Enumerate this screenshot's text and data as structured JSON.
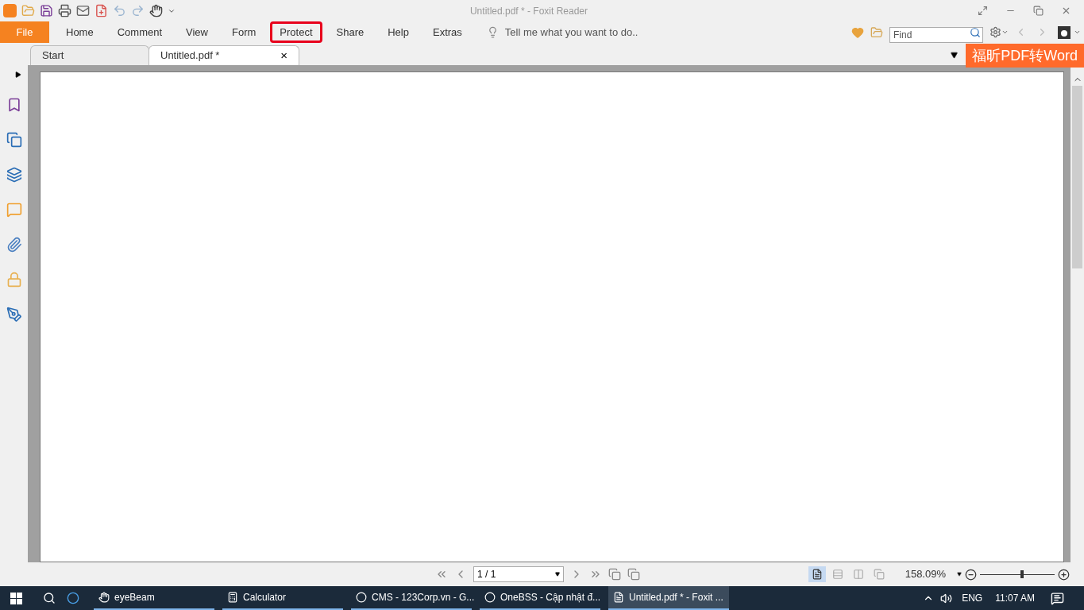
{
  "window": {
    "title": "Untitled.pdf * - Foxit Reader"
  },
  "ribbon_tabs": [
    {
      "label": "File",
      "kind": "file",
      "highlighted": false
    },
    {
      "label": "Home",
      "kind": "tab",
      "highlighted": false
    },
    {
      "label": "Comment",
      "kind": "tab",
      "highlighted": false
    },
    {
      "label": "View",
      "kind": "tab",
      "highlighted": false
    },
    {
      "label": "Form",
      "kind": "tab",
      "highlighted": false
    },
    {
      "label": "Protect",
      "kind": "tab",
      "highlighted": true
    },
    {
      "label": "Share",
      "kind": "tab",
      "highlighted": false
    },
    {
      "label": "Help",
      "kind": "tab",
      "highlighted": false
    },
    {
      "label": "Extras",
      "kind": "tab",
      "highlighted": false
    }
  ],
  "tell_me": {
    "placeholder": "Tell me what you want to do.."
  },
  "find": {
    "placeholder": "Find"
  },
  "doc_tabs": [
    {
      "label": "Start",
      "selected": false
    },
    {
      "label": "Untitled.pdf *",
      "selected": true,
      "close": "×"
    }
  ],
  "promo_banner": "福昕PDF转Word",
  "status_bar": {
    "page_field": "1 / 1",
    "zoom": "158.09%",
    "level": 0.56,
    "view_modes": [
      {
        "selected": true
      },
      {
        "selected": false
      },
      {
        "selected": false
      },
      {
        "selected": false
      }
    ]
  },
  "taskbar": {
    "apps": [
      {
        "label": "eyeBeam",
        "selected": false
      },
      {
        "label": "Calculator",
        "selected": false
      },
      {
        "label": "CMS - 123Corp.vn - G...",
        "selected": false
      },
      {
        "label": "OneBSS - Cập nhật đ...",
        "selected": false
      },
      {
        "label": "Untitled.pdf * - Foxit ...",
        "selected": true
      }
    ],
    "language": "ENG",
    "time": "11:07 AM"
  }
}
